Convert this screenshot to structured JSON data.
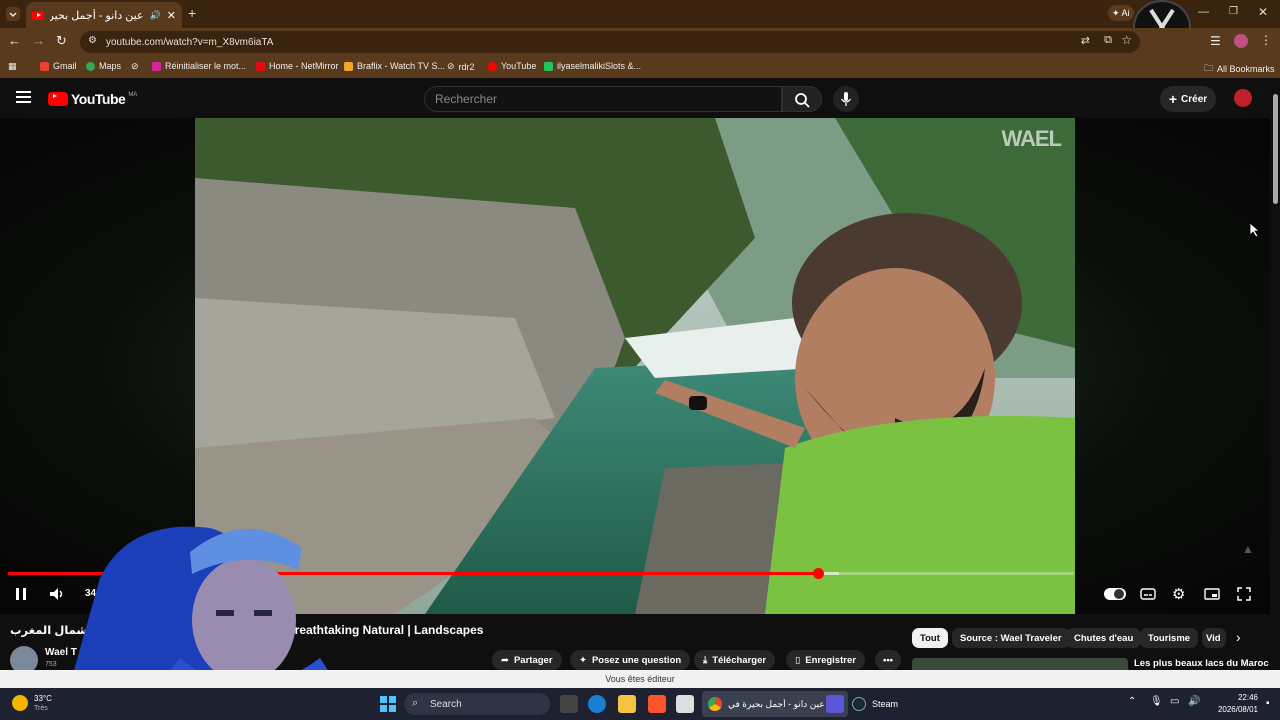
{
  "browser": {
    "tab_title": "عين دانو - أجمل بحيرة في ش...",
    "url": "youtube.com/watch?v=m_X8vm6iaTA",
    "bookmarks": [
      "Gmail",
      "Maps",
      "Réinitialiser le mot...",
      "Home - NetMirror",
      "Braflix - Watch TV S...",
      "rdr2",
      "YouTube",
      "ilyaselmalikiSlots &..."
    ],
    "all_bookmarks": "All Bookmarks"
  },
  "youtube": {
    "logo_text": "YouTube",
    "country_code": "MA",
    "search_placeholder": "Rechercher",
    "create_label": "Créer"
  },
  "player": {
    "watermark": "WAEL",
    "current_time": "34:35 /",
    "progress_played": 0.76,
    "progress_buffered": 0.78
  },
  "video": {
    "title_ar": "بحيرة في شمال المغرب",
    "title_en": "Breathtaking Natural | Landscapes",
    "channel_name": "Wael T",
    "subscribers": "753"
  },
  "actions": {
    "share": "Partager",
    "ask": "Posez une question",
    "download": "Télécharger",
    "save": "Enregistrer"
  },
  "chips": [
    "Tout",
    "Source : Wael Traveler",
    "Chutes d'eau",
    "Tourisme",
    "Vid"
  ],
  "recommendation_title": "Les plus beaux lacs du Maroc",
  "editor_notice": "Vous êtes éditeur",
  "taskbar": {
    "weather_temp": "33°C",
    "weather_desc": "Très",
    "search_label": "Search",
    "chrome_window": "عين دانو - أجمل بحيرة في",
    "steam_label": "Steam",
    "time": "22:46",
    "date": "2026/08/01"
  },
  "colors": {
    "chrome_frame": "#5a3a1c",
    "youtube_red": "#ff0000",
    "bg": "#0f0f0f"
  }
}
